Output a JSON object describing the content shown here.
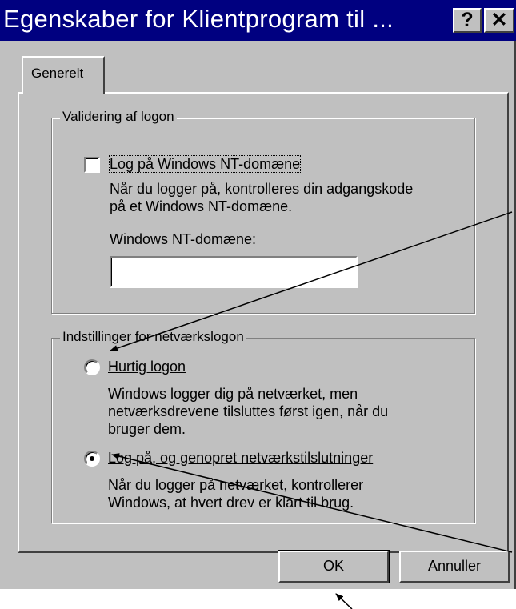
{
  "window": {
    "title": "Egenskaber for Klientprogram til ...",
    "help_label": "?",
    "close_label": "✕"
  },
  "tabs": [
    {
      "label": "Generelt"
    }
  ],
  "logon_validation": {
    "legend": "Validering af logon",
    "checkbox_label": "Log på Windows NT-domæne",
    "checkbox_checked": false,
    "description_line1": "Når du logger på, kontrolleres din adgangskode",
    "description_line2": "på et Windows NT-domæne.",
    "domain_field_label": "Windows NT-domæne:",
    "domain_value": ""
  },
  "network_logon": {
    "legend": "Indstillinger for netværkslogon",
    "options": [
      {
        "label": "Hurtig logon",
        "selected": false,
        "description": [
          "Windows logger dig på netværket, men",
          "netværksdrevene tilsluttes først igen, når du",
          "bruger dem."
        ]
      },
      {
        "label": "Log på, og genopret netværkstilslutninger",
        "selected": true,
        "description": [
          "Når du logger på netværket, kontrollerer",
          "Windows, at hvert drev er klart til brug."
        ]
      }
    ]
  },
  "buttons": {
    "ok": "OK",
    "cancel": "Annuller"
  },
  "colors": {
    "titlebar": "#000080",
    "face": "#c0c0c0"
  }
}
